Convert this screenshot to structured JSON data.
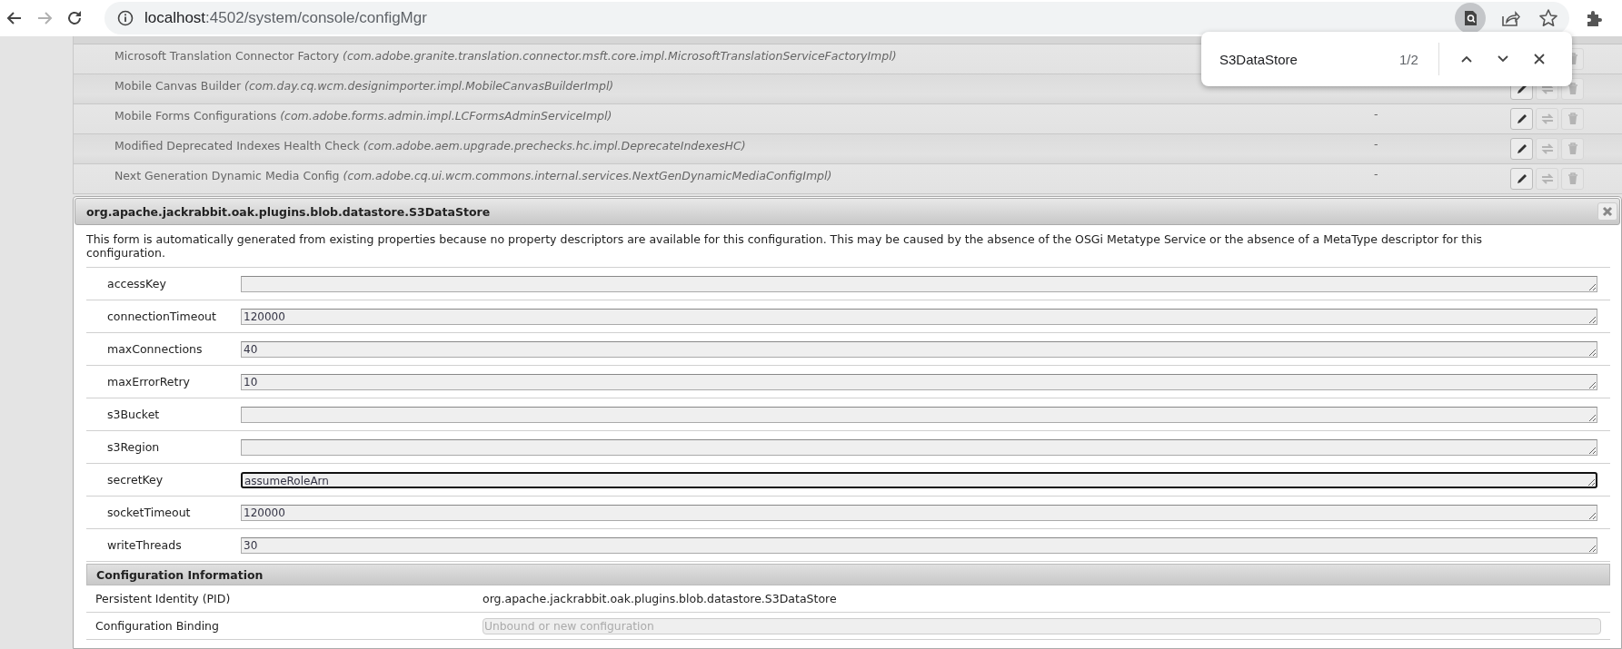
{
  "browser": {
    "nav": [
      {
        "kind": "back",
        "disabled": false
      },
      {
        "kind": "forward",
        "disabled": true
      },
      {
        "kind": "reload",
        "disabled": false
      }
    ],
    "url_host": "localhost",
    "url_path": ":4502/system/console/configMgr",
    "find_in_page_active": true
  },
  "config_rows": [
    {
      "name": "Microsoft Translation Connector Factory",
      "pid": "(com.adobe.granite.translation.connector.msft.core.impl.MicrosoftTranslationServiceFactoryImpl)",
      "actions": [
        {
          "kind": "delete",
          "disabled": true
        }
      ]
    },
    {
      "name": "Mobile Canvas Builder",
      "pid": "(com.day.cq.wcm.designimporter.impl.MobileCanvasBuilderImpl)",
      "actions": [
        {
          "kind": "edit",
          "disabled": false
        },
        {
          "kind": "unbind",
          "disabled": true
        },
        {
          "kind": "delete",
          "disabled": true
        }
      ]
    },
    {
      "name": "Mobile Forms Configurations",
      "pid": "(com.adobe.forms.admin.impl.LCFormsAdminServiceImpl)",
      "column_2": "-",
      "actions": [
        {
          "kind": "edit",
          "disabled": false
        },
        {
          "kind": "unbind",
          "disabled": true
        },
        {
          "kind": "delete",
          "disabled": true
        }
      ]
    },
    {
      "name": "Modified Deprecated Indexes Health Check",
      "pid": "(com.adobe.aem.upgrade.prechecks.hc.impl.DeprecateIndexesHC)",
      "column_2": "-",
      "actions": [
        {
          "kind": "edit",
          "disabled": false
        },
        {
          "kind": "unbind",
          "disabled": true
        },
        {
          "kind": "delete",
          "disabled": true
        }
      ]
    },
    {
      "name": "Next Generation Dynamic Media Config",
      "pid": "(com.adobe.cq.ui.wcm.commons.internal.services.NextGenDynamicMediaConfigImpl)",
      "column_2": "-",
      "actions": [
        {
          "kind": "edit",
          "disabled": false
        },
        {
          "kind": "unbind",
          "disabled": true
        },
        {
          "kind": "delete",
          "disabled": true
        }
      ]
    }
  ],
  "find_bar": {
    "query": "S3DataStore",
    "count": "1/2"
  },
  "dialog": {
    "title": "org.apache.jackrabbit.oak.plugins.blob.datastore.S3DataStore",
    "description": "This form is automatically generated from existing properties because no property descriptors are available for this configuration. This may be caused by the absence of the OSGi Metatype Service or the absence of a MetaType descriptor for this configuration.",
    "properties": [
      {
        "name": "accessKey",
        "focused": false
      },
      {
        "name": "connectionTimeout",
        "value": "120000",
        "focused": false
      },
      {
        "name": "maxConnections",
        "value": "40",
        "focused": false
      },
      {
        "name": "maxErrorRetry",
        "value": "10",
        "focused": false
      },
      {
        "name": "s3Bucket",
        "focused": false
      },
      {
        "name": "s3Region",
        "focused": false
      },
      {
        "name": "secretKey",
        "value": "assumeRoleArn",
        "focused": true
      },
      {
        "name": "socketTimeout",
        "value": "120000",
        "focused": false
      },
      {
        "name": "writeThreads",
        "value": "30",
        "focused": false
      }
    ],
    "info": {
      "title": "Configuration Information",
      "rows": [
        {
          "label": "Persistent Identity (PID)",
          "kind": "text",
          "value": "org.apache.jackrabbit.oak.plugins.blob.datastore.S3DataStore"
        },
        {
          "label": "Configuration Binding",
          "kind": "select",
          "value": "Unbound or new configuration",
          "disabled": true
        }
      ]
    }
  }
}
